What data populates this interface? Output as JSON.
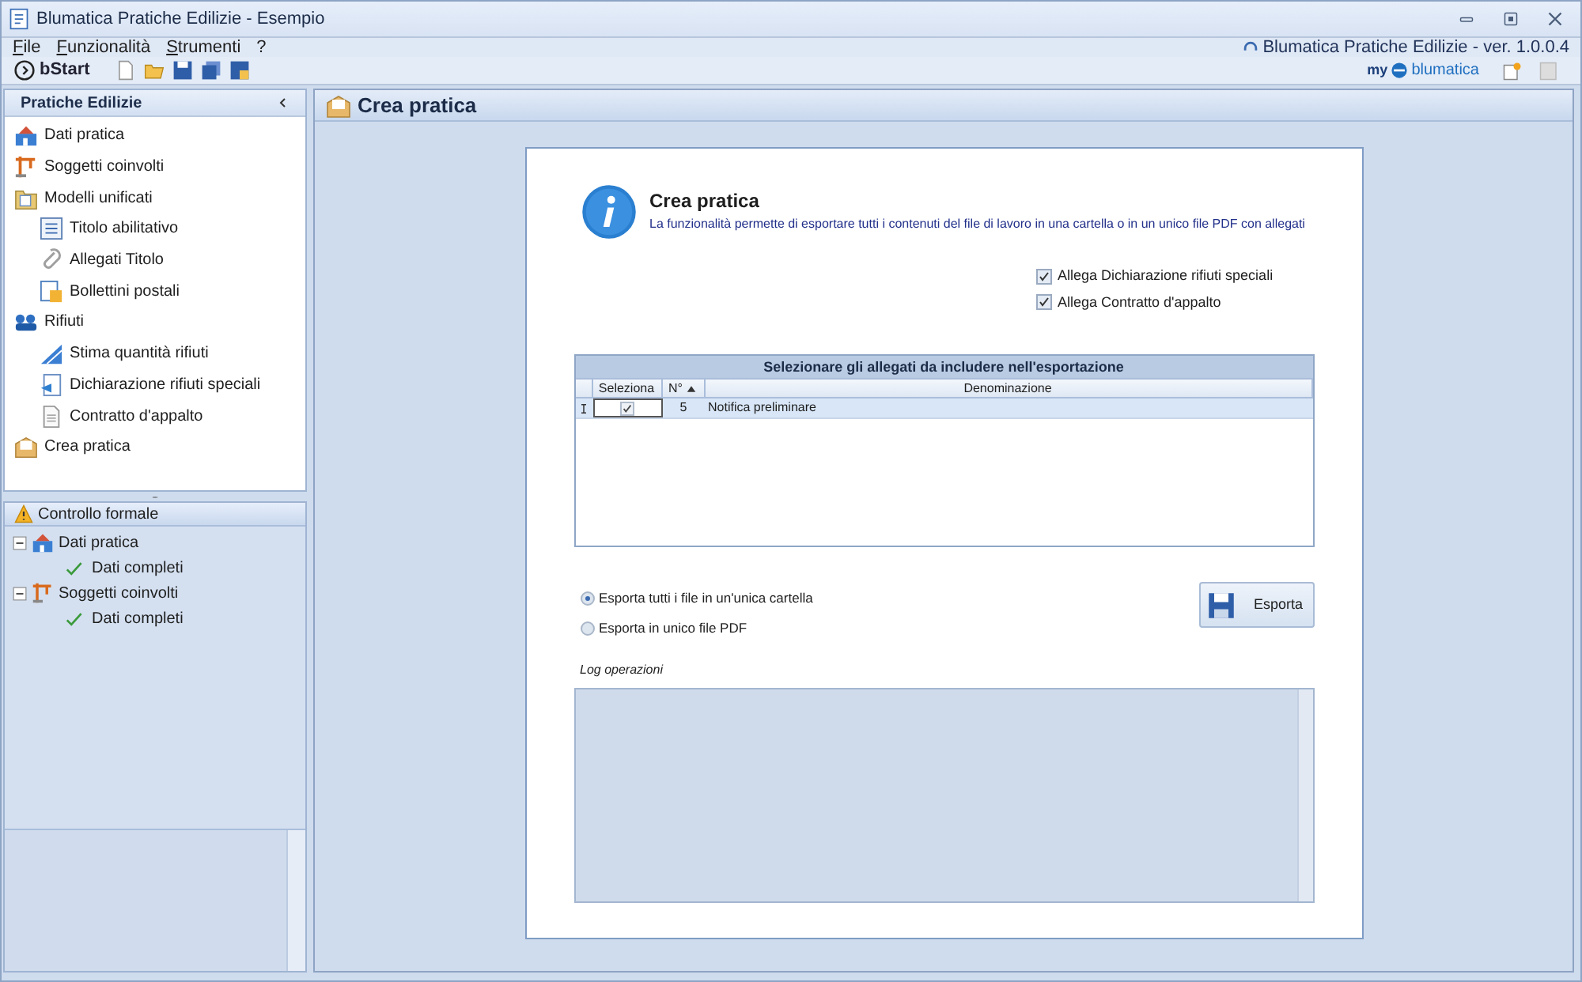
{
  "window": {
    "title": "Blumatica Pratiche Edilizie - Esempio"
  },
  "menu": [
    "File",
    "Funzionalità",
    "Strumenti",
    "?"
  ],
  "app_version": "Blumatica Pratiche Edilizie - ver. 1.0.0.4",
  "toolbar": {
    "start_label": "bStart"
  },
  "logo": {
    "prefix": "my",
    "name": "blumatica"
  },
  "sidebar": {
    "title": "Pratiche Edilizie",
    "items": [
      {
        "label": "Dati pratica"
      },
      {
        "label": "Soggetti coinvolti"
      },
      {
        "label": "Modelli unificati",
        "children": [
          {
            "label": "Titolo abilitativo"
          },
          {
            "label": "Allegati Titolo"
          },
          {
            "label": "Bollettini postali"
          }
        ]
      },
      {
        "label": "Rifiuti",
        "children": [
          {
            "label": "Stima quantità rifiuti"
          },
          {
            "label": "Dichiarazione rifiuti speciali"
          },
          {
            "label": "Contratto d'appalto"
          }
        ]
      },
      {
        "label": "Crea pratica"
      }
    ]
  },
  "check_panel": {
    "title": "Controllo formale",
    "tree": [
      {
        "label": "Dati pratica",
        "expanded": true,
        "children": [
          {
            "label": "Dati completi"
          }
        ]
      },
      {
        "label": "Soggetti coinvolti",
        "expanded": true,
        "children": [
          {
            "label": "Dati completi"
          }
        ]
      }
    ]
  },
  "page": {
    "title": "Crea pratica",
    "info_title": "Crea pratica",
    "info_text": "La funzionalità permette di esportare tutti i contenuti del file di lavoro in una cartella o in un unico file PDF con allegati",
    "options": [
      {
        "label": "Allega Dichiarazione rifiuti speciali",
        "checked": true
      },
      {
        "label": "Allega Contratto d'appalto",
        "checked": true
      }
    ],
    "table": {
      "title": "Selezionare gli allegati da includere nell'esportazione",
      "columns": [
        "Seleziona",
        "N°",
        "Denominazione"
      ],
      "rows": [
        {
          "selected": true,
          "checked": true,
          "number": "5",
          "name": "Notifica preliminare"
        }
      ]
    },
    "export_modes": [
      {
        "label": "Esporta tutti i file in un'unica cartella",
        "selected": true
      },
      {
        "label": "Esporta in unico file PDF",
        "selected": false
      }
    ],
    "export_button": "Esporta",
    "log_label": "Log operazioni"
  }
}
